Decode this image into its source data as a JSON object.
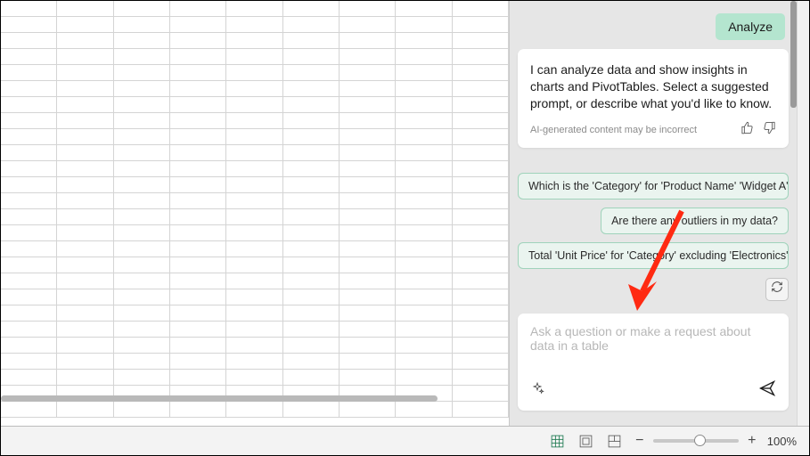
{
  "pane": {
    "analyze_label": "Analyze",
    "intro_text": "I can analyze data and show insights in charts and PivotTables. Select a suggested prompt, or describe what you'd like to know.",
    "disclaimer": "AI-generated content may be incorrect",
    "suggestions": [
      "Which is the 'Category' for 'Product Name' 'Widget A'",
      "Are there any outliers in my data?",
      "Total 'Unit Price' for 'Category' excluding 'Electronics'"
    ],
    "input_placeholder": "Ask a question or make a request about data in a table"
  },
  "statusbar": {
    "zoom_value": "100%"
  }
}
